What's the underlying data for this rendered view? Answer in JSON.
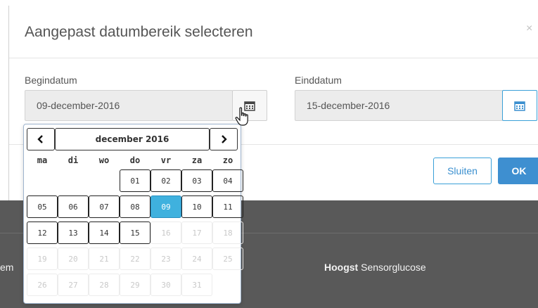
{
  "modal": {
    "title": "Aangepast datumbereik selecteren",
    "close_icon": "close-x-icon"
  },
  "begin": {
    "label": "Begindatum",
    "value": "09-december-2016",
    "icon": "calendar-icon"
  },
  "end": {
    "label": "Einddatum",
    "value": "15-december-2016",
    "icon": "calendar-icon"
  },
  "buttons": {
    "close": "Sluiten",
    "ok": "OK"
  },
  "datepicker": {
    "prev": "‹",
    "next": "›",
    "title": "december 2016",
    "dow": [
      "ma",
      "di",
      "wo",
      "do",
      "vr",
      "za",
      "zo"
    ],
    "weeks": [
      [
        null,
        null,
        null,
        "01",
        "02",
        "03",
        "04"
      ],
      [
        "05",
        "06",
        "07",
        "08",
        "09",
        "10",
        "11"
      ],
      [
        "12",
        "13",
        "14",
        "15",
        "16",
        "17",
        "18"
      ],
      [
        "19",
        "20",
        "21",
        "22",
        "23",
        "24",
        "25"
      ],
      [
        "26",
        "27",
        "28",
        "29",
        "30",
        "31",
        null
      ]
    ],
    "selected": "09",
    "disabled": [
      "16",
      "17",
      "18",
      "19",
      "20",
      "21",
      "22",
      "23",
      "24",
      "25",
      "26",
      "27",
      "28",
      "29",
      "30",
      "31"
    ]
  },
  "background": {
    "left_fragment": "em",
    "hoogst_bold": "Hoogst",
    "hoogst_rest": " Sensorglucose"
  },
  "colors": {
    "accent": "#3e8fd0",
    "selected_day": "#3fb1de",
    "backdrop": "#595959"
  },
  "cursor_icon": "hand-pointer-icon"
}
